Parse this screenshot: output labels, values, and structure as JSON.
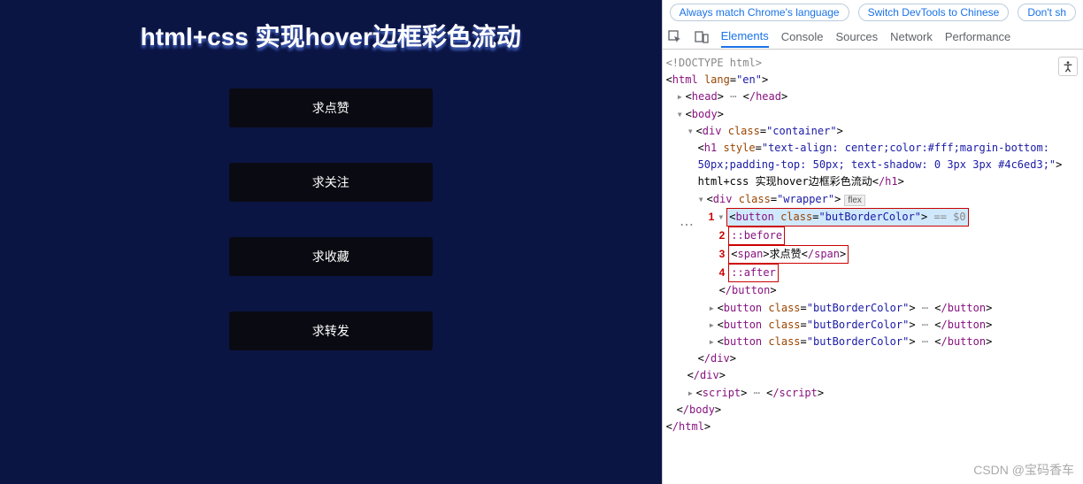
{
  "preview": {
    "title": "html+css 实现hover边框彩色流动",
    "buttons": [
      "求点赞",
      "求关注",
      "求收藏",
      "求转发"
    ]
  },
  "devtools": {
    "infobar": {
      "match_lang": "Always match Chrome's language",
      "switch_cn": "Switch DevTools to Chinese",
      "dont_show": "Don't sh"
    },
    "tabs": {
      "elements": "Elements",
      "console": "Console",
      "sources": "Sources",
      "network": "Network",
      "performance": "Performance"
    },
    "dom": {
      "doctype": "<!DOCTYPE html>",
      "html_open": "html",
      "html_lang_attr": "lang",
      "html_lang_val": "\"en\"",
      "head_open": "head",
      "head_close": "/head",
      "body": "body",
      "div_container_attr": "class",
      "div_container_val": "\"container\"",
      "h1_style_attr": "style",
      "h1_style_val": "\"text-align: center;color:#fff;margin-bottom: 50px;padding-top: 50px; text-shadow: 0 3px 3px #4c6ed3;\"",
      "h1_text": " html+css 实现hover边框彩色流动",
      "wrapper_attr": "class",
      "wrapper_val": "\"wrapper\"",
      "flex_badge": "flex",
      "button_class_attr": "class",
      "button_class_val": "\"butBorderColor\"",
      "before": "::before",
      "span_text": "求点赞",
      "after": "::after",
      "button_close": "/button",
      "script": "script",
      "div_close": "/div",
      "body_close": "/body",
      "html_close": "/html",
      "eq_dollar": " == $0",
      "n1": "1",
      "n2": "2",
      "n3": "3",
      "n4": "4"
    }
  },
  "watermark": "CSDN @宝码香车",
  "a11y_icon": "�43"
}
